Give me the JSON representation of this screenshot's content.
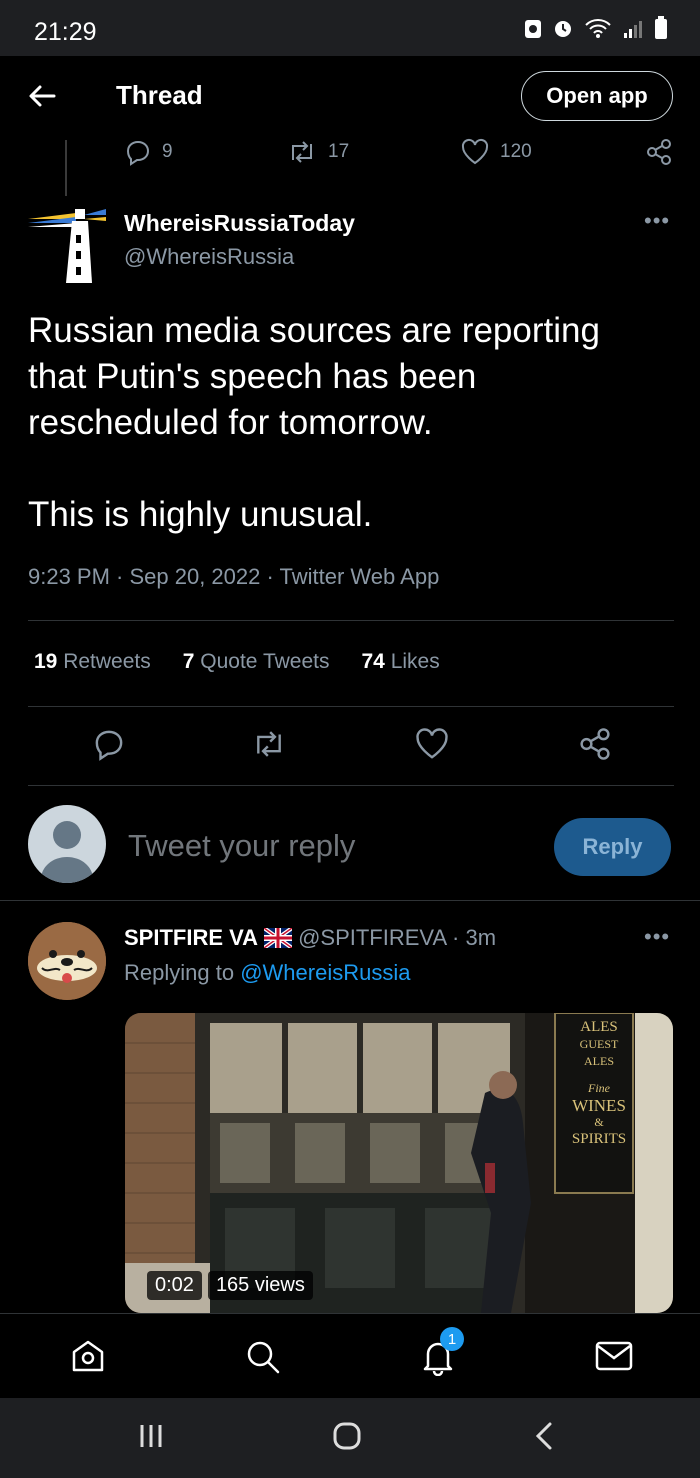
{
  "status_bar": {
    "time": "21:29"
  },
  "header": {
    "title": "Thread",
    "open_app": "Open app"
  },
  "prev_tweet_stats": {
    "replies": "9",
    "retweets": "17",
    "likes": "120"
  },
  "tweet": {
    "display_name": "WhereisRussiaToday",
    "handle": "@WhereisRussia",
    "text_line1": "Russian media sources are reporting",
    "text_line2": "that Putin's speech has been",
    "text_line3": "rescheduled for tomorrow.",
    "text_line4": "This is highly unusual.",
    "meta": "9:23 PM · Sep 20, 2022 · Twitter Web App",
    "retweets_count": "19",
    "retweets_label": "Retweets",
    "quotes_count": "7",
    "quotes_label": "Quote Tweets",
    "likes_count": "74",
    "likes_label": "Likes"
  },
  "composer": {
    "placeholder": "Tweet your reply",
    "reply_button": "Reply"
  },
  "reply_tweet": {
    "display_name": "SPITFIRE VA",
    "handle_time": "@SPITFIREVA · 3m",
    "replying_prefix": "Replying to",
    "replying_to": "@WhereisRussia",
    "video_time": "0:02",
    "video_views": "165 views"
  },
  "bottom_nav": {
    "notifications_badge": "1"
  },
  "colors": {
    "accent": "#1d9bf0",
    "background": "#000000",
    "muted": "#8b98a5"
  }
}
